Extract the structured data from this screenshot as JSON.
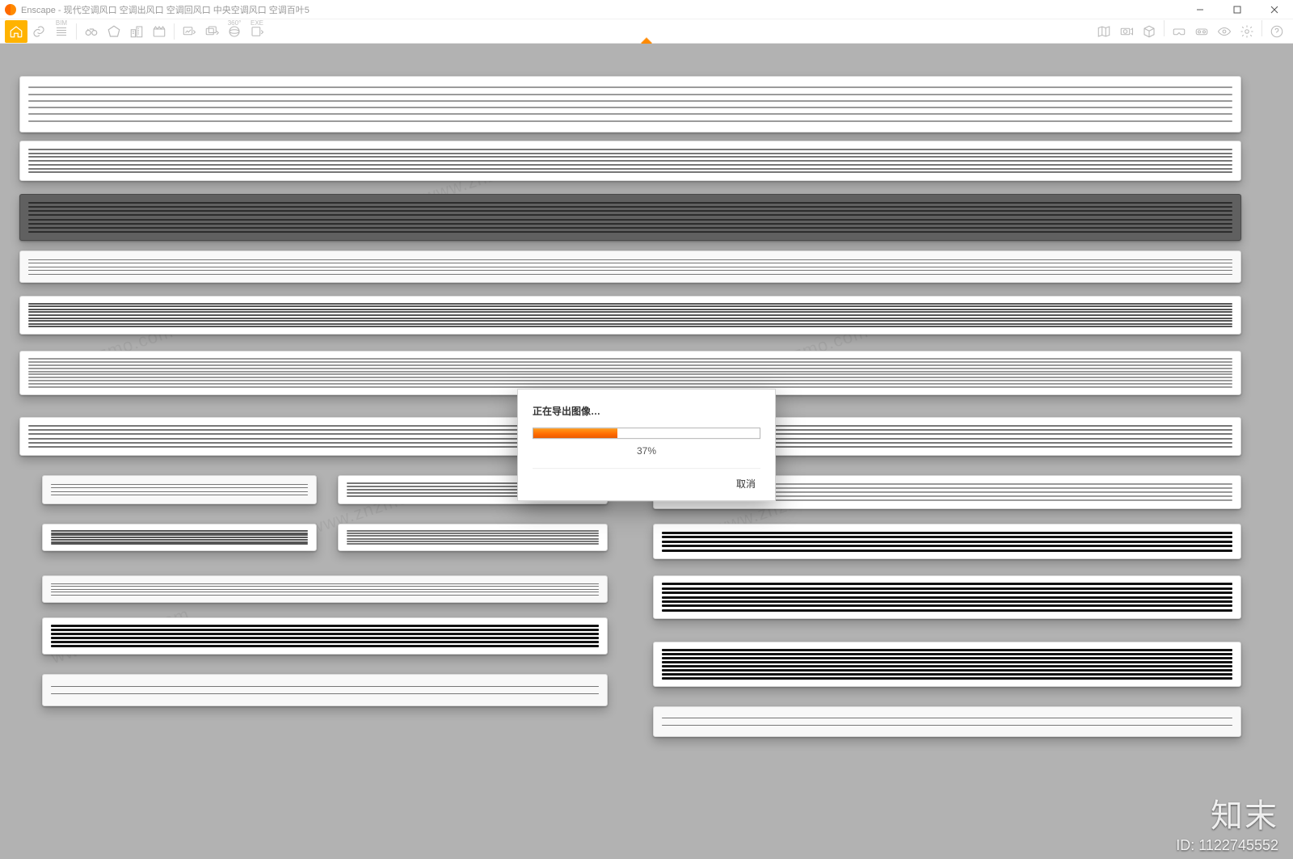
{
  "window": {
    "title": "Enscape - 现代空调风口 空调出风口 空调回风口 中央空调风口 空调百叶5",
    "controls": {
      "minimize": "minimize-icon",
      "maximize": "maximize-icon",
      "close": "close-icon"
    }
  },
  "toolbar": {
    "left": [
      {
        "name": "home-icon",
        "active": true
      },
      {
        "name": "link-icon"
      },
      {
        "name": "bim-icon",
        "label": "BIM"
      },
      {
        "name": "binoculars-icon"
      },
      {
        "name": "polygon-icon"
      },
      {
        "name": "buildings-icon"
      },
      {
        "name": "clapperboard-icon"
      },
      {
        "name": "image-export-icon"
      },
      {
        "name": "batch-export-icon"
      },
      {
        "name": "pano-360-icon",
        "label": "360°"
      },
      {
        "name": "exe-export-icon",
        "label": "EXE"
      }
    ],
    "right": [
      {
        "name": "map-icon"
      },
      {
        "name": "camera-ortho-icon"
      },
      {
        "name": "cube-icon"
      },
      {
        "name": "vr-icon"
      },
      {
        "name": "vr-headset-icon"
      },
      {
        "name": "eye-icon"
      },
      {
        "name": "gear-icon"
      },
      {
        "name": "help-icon"
      }
    ]
  },
  "dialog": {
    "title": "正在导出图像…",
    "percent_text": "37%",
    "percent_value": 37,
    "cancel": "取消"
  },
  "overlay": {
    "brand": "知末",
    "id_label": "ID: 1122745552"
  },
  "watermark_text": "www.znzmo.com"
}
